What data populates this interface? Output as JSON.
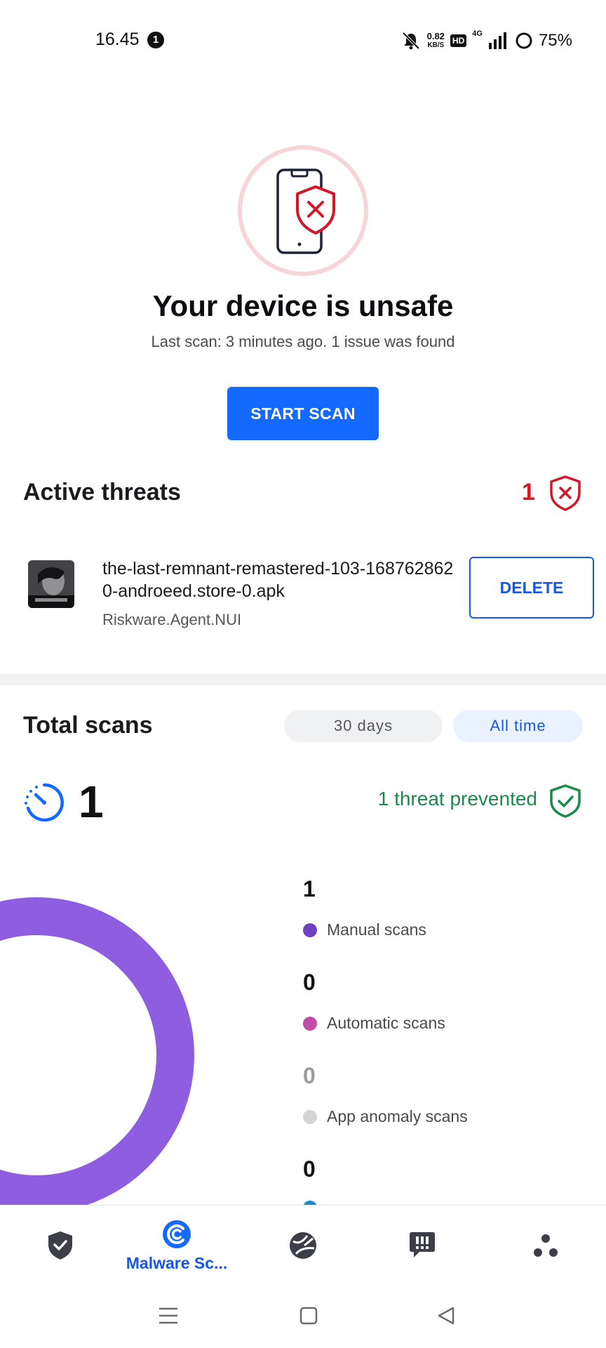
{
  "status_bar": {
    "time": "16.45",
    "notification_count": "1",
    "speed_value": "0.82",
    "speed_unit": "KB/S",
    "hd_badge": "HD",
    "network": "4G",
    "battery": "75%"
  },
  "hero": {
    "title": "Your device is unsafe",
    "subtitle": "Last scan: 3 minutes ago. 1 issue was found",
    "scan_button": "START SCAN"
  },
  "active_threats": {
    "title": "Active threats",
    "count": "1",
    "items": [
      {
        "file_name": "the-last-remnant-remastered-103-1687628620-androeed.store-0.apk",
        "threat_name": "Riskware.Agent.NUI",
        "action": "DELETE"
      }
    ]
  },
  "total_scans": {
    "title": "Total scans",
    "range_options": [
      "30 days",
      "All time"
    ],
    "selected_range": "All time",
    "total": "1",
    "prevented": "1 threat prevented",
    "breakdown": [
      {
        "count": "1",
        "label": "Manual scans",
        "color": "#6f3fc4"
      },
      {
        "count": "0",
        "label": "Automatic scans",
        "color": "#c04fa8"
      },
      {
        "count": "0",
        "label": "App anomaly scans",
        "color": "#d4d4d6"
      },
      {
        "count": "0",
        "label": "",
        "color": "#1a8ad4"
      }
    ],
    "donut_color": "#8f5de0"
  },
  "bottom_nav": {
    "active_label": "Malware Sc...",
    "items": [
      "shield-check-icon",
      "malware-scan-icon",
      "browser-globe-icon",
      "chat-alert-icon",
      "more-dots-icon"
    ]
  },
  "colors": {
    "accent": "#1469ff",
    "danger": "#d3182a",
    "success": "#1a8a4a"
  }
}
